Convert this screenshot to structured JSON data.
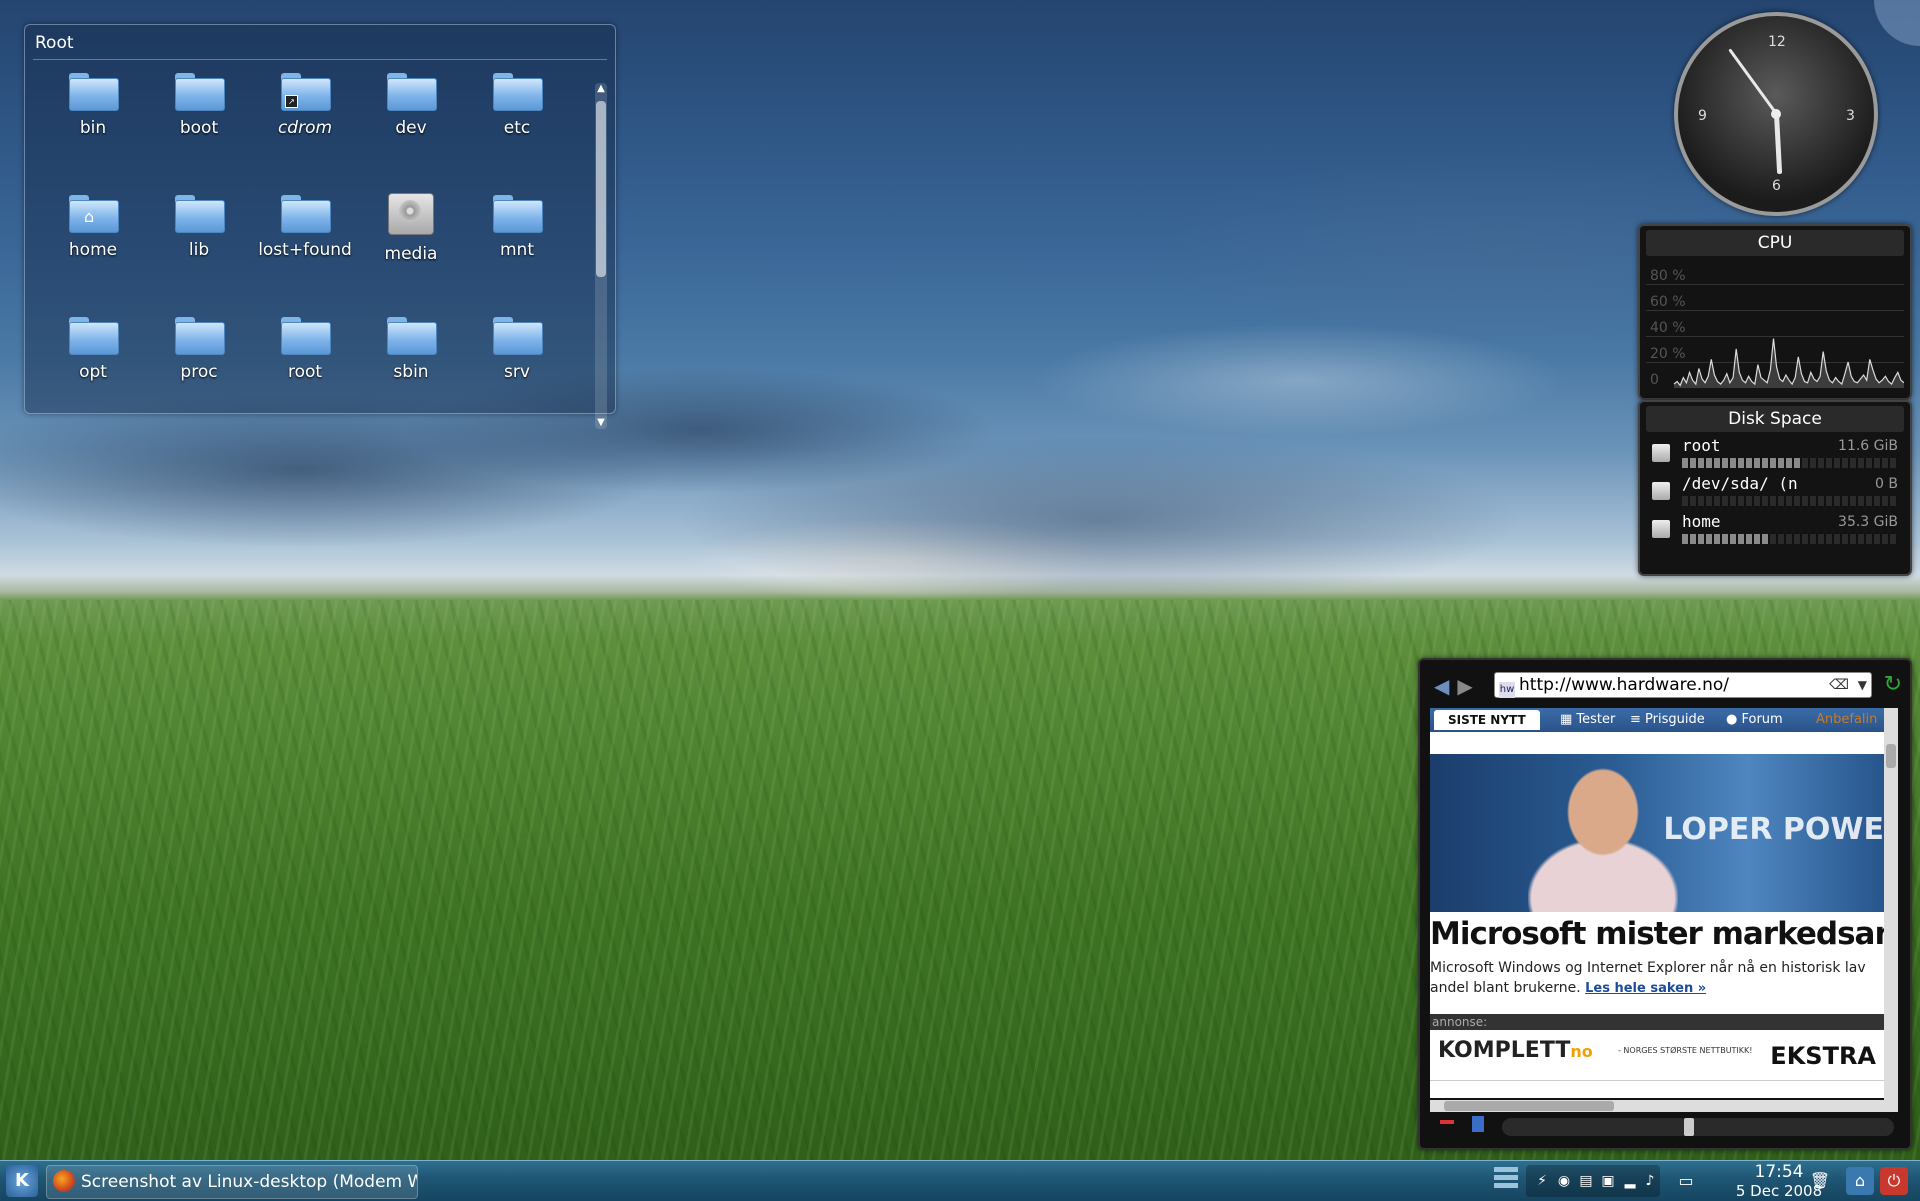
{
  "folderview": {
    "title": "Root",
    "items": [
      {
        "label": "bin",
        "icon": "folder-icon"
      },
      {
        "label": "boot",
        "icon": "folder-icon"
      },
      {
        "label": "cdrom",
        "icon": "folder-link-icon",
        "italic": true
      },
      {
        "label": "dev",
        "icon": "folder-icon"
      },
      {
        "label": "etc",
        "icon": "folder-icon"
      },
      {
        "label": "home",
        "icon": "home-folder-icon"
      },
      {
        "label": "lib",
        "icon": "folder-icon"
      },
      {
        "label": "lost+found",
        "icon": "folder-icon"
      },
      {
        "label": "media",
        "icon": "hard-disk-icon"
      },
      {
        "label": "mnt",
        "icon": "folder-icon"
      },
      {
        "label": "opt",
        "icon": "folder-icon"
      },
      {
        "label": "proc",
        "icon": "folder-icon"
      },
      {
        "label": "root",
        "icon": "folder-icon"
      },
      {
        "label": "sbin",
        "icon": "folder-icon"
      },
      {
        "label": "srv",
        "icon": "folder-icon"
      }
    ]
  },
  "clock": {
    "numerals": [
      "12",
      "3",
      "6",
      "9"
    ],
    "hour": 17,
    "minute": 54
  },
  "cpu": {
    "title": "CPU",
    "gridlabels": [
      "80 %",
      "60 %",
      "40 %",
      "20 %",
      "0"
    ],
    "samples": [
      3,
      5,
      2,
      8,
      4,
      12,
      6,
      3,
      15,
      7,
      4,
      9,
      22,
      10,
      5,
      3,
      6,
      11,
      4,
      8,
      30,
      12,
      6,
      4,
      9,
      5,
      3,
      18,
      8,
      6,
      4,
      14,
      38,
      16,
      7,
      5,
      10,
      6,
      3,
      8,
      24,
      11,
      5,
      4,
      12,
      7,
      5,
      9,
      28,
      13,
      6,
      4,
      8,
      5,
      3,
      11,
      20,
      9,
      5,
      4,
      7,
      10,
      6,
      22,
      14,
      7,
      4,
      6,
      9,
      5,
      3,
      8,
      12,
      6,
      4
    ]
  },
  "disk": {
    "title": "Disk Space",
    "rows": [
      {
        "name": "root",
        "size": "11.6 GiB",
        "used_fraction": 0.55
      },
      {
        "name": "/dev/sda/ (n",
        "size": "0 B",
        "used_fraction": 0.0
      },
      {
        "name": "home",
        "size": "35.3 GiB",
        "used_fraction": 0.4
      }
    ]
  },
  "browser": {
    "url": "http://www.hardware.no/",
    "favicon": "hw",
    "tabs": {
      "active": "SISTE NYTT",
      "items": [
        "Tester",
        "Prisguide",
        "Forum"
      ],
      "extra": "Anbefalin"
    },
    "photo_banner": "LOPER POWE",
    "headline": "Microsoft mister markedsandeler",
    "body": "Microsoft Windows og Internet Explorer når nå en historisk lav andel blant brukerne.",
    "more_link": "Les hele saken »",
    "ad_label": "annonse:",
    "ad_logo": "KOMPLETT",
    "ad_logo_suffix": "no",
    "ad_tagline": "- NORGES STØRSTE NETTBUTIKK!",
    "ad_extra": "EKSTRA"
  },
  "taskbar": {
    "task_label": "Screenshot av Linux-desktop (Modem W",
    "time": "17:54",
    "date": "5 Dec 2008"
  }
}
